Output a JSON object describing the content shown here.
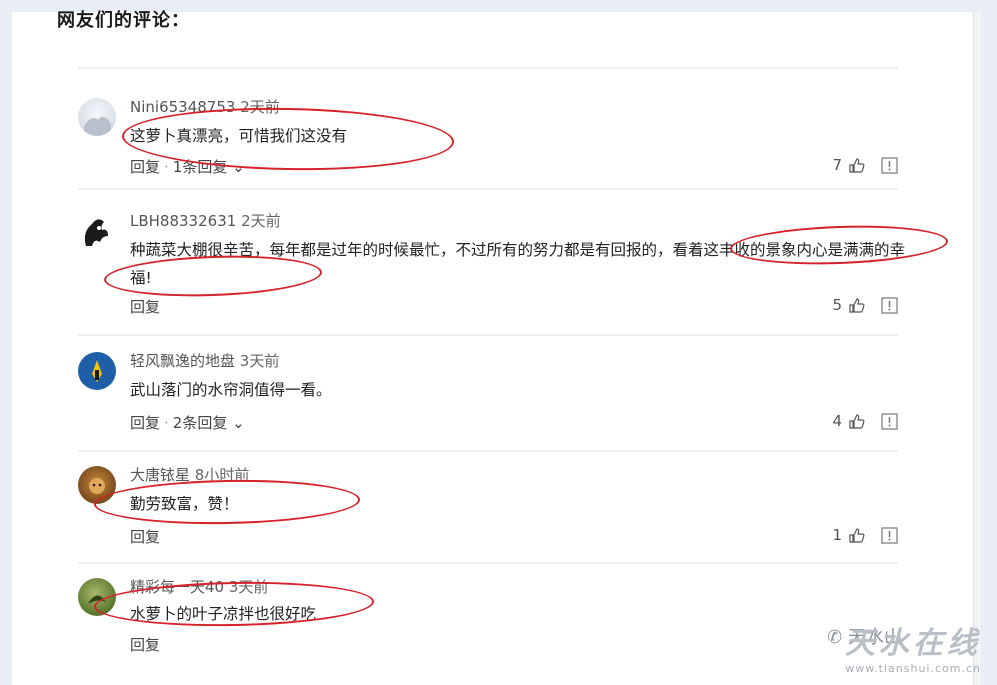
{
  "heading": "网友们的评论：",
  "comments": [
    {
      "user": "Nini65348753",
      "time": "2天前",
      "text": "这萝卜真漂亮，可惜我们这没有",
      "reply": "回复",
      "reply_count": "1条回复",
      "likes": "7"
    },
    {
      "user": "LBH88332631",
      "time": "2天前",
      "text": "种蔬菜大棚很辛苦，每年都是过年的时候最忙，不过所有的努力都是有回报的，看着这丰收的景象内心是满满的幸福!",
      "reply": "回复",
      "reply_count": "",
      "likes": "5"
    },
    {
      "user": "轻风飘逸的地盘",
      "time": "3天前",
      "text": "武山落门的水帘洞值得一看。",
      "reply": "回复",
      "reply_count": "2条回复",
      "likes": "4"
    },
    {
      "user": "大唐铱星",
      "time": "8小时前",
      "text": "勤劳致富，赞！",
      "reply": "回复",
      "reply_count": "",
      "likes": "1"
    },
    {
      "user": "精彩每一天40",
      "time": "3天前",
      "text": "水萝卜的叶子凉拌也很好吃",
      "reply": "回复",
      "reply_count": "",
      "likes": ""
    }
  ],
  "watermark": {
    "logo": "天水在线",
    "url": "www.tianshui.com.cn",
    "wechat": "天水山"
  },
  "colors": {
    "annotation": "#d6222a",
    "text": "#222222",
    "meta": "#555555",
    "divider": "#f0f0f0"
  }
}
